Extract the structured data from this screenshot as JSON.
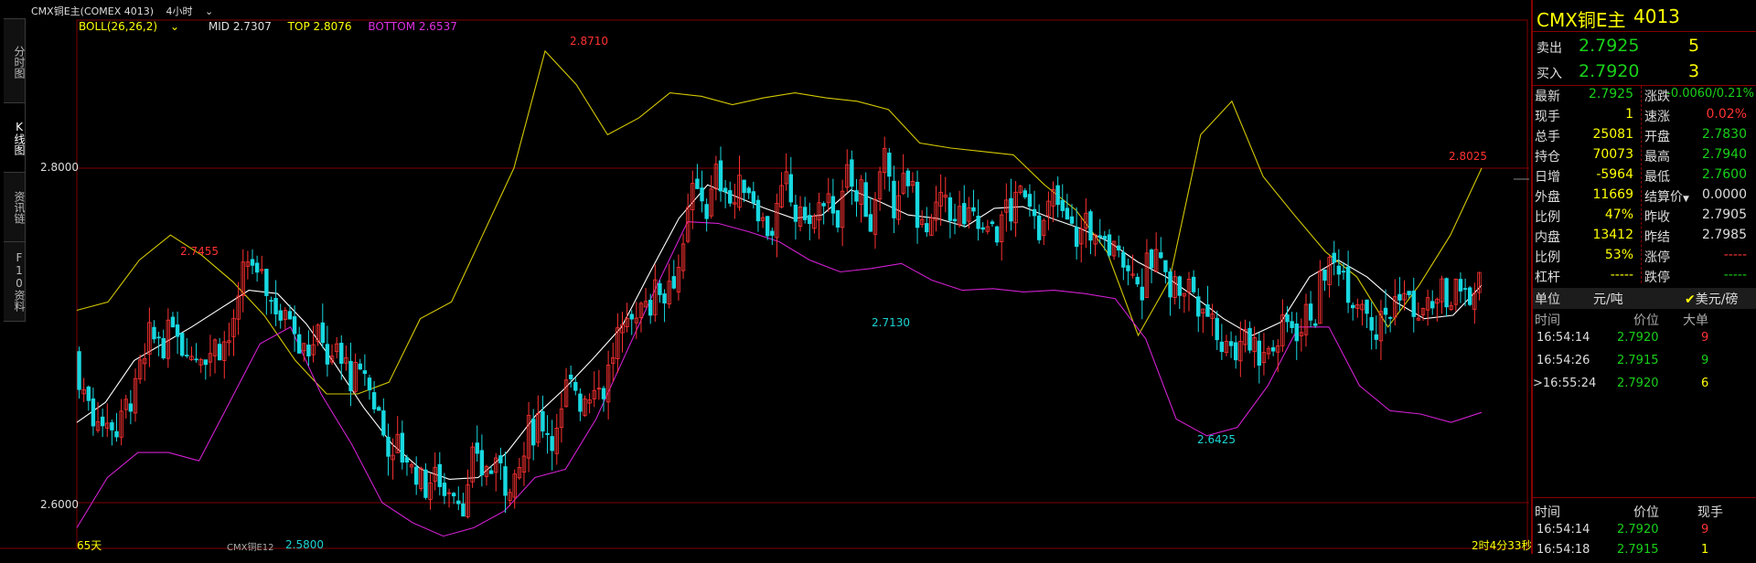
{
  "colors": {
    "up": "#ff3232",
    "down": "#18d8e0",
    "mid": "#ffffff",
    "top": "#d4c800",
    "bottom": "#d020d0",
    "grid": "#800000"
  },
  "topbar": {
    "symbol": "CMX铜E主(COMEX 4013)",
    "period": "4小时",
    "period_icon": "chevron-down-icon"
  },
  "tabs": [
    {
      "label": "分时图"
    },
    {
      "label": "K线图"
    },
    {
      "label": "资讯链"
    },
    {
      "label": "F10资料"
    }
  ],
  "legend": {
    "boll": "BOLL(26,26,2)",
    "mid": "MID 2.7307",
    "top": "TOP 2.8076",
    "bottom": "BOTTOM 2.6537"
  },
  "yaxis": {
    "high": "2.8000",
    "low": "2.6000"
  },
  "annotations": {
    "a1": "2.8710",
    "a2": "2.7455",
    "a3": "2.7130",
    "a4": "2.6425",
    "a5": "2.8025",
    "a6": "2.5800"
  },
  "footer": {
    "days": "65天",
    "contract": "CMX铜E12",
    "countdown": "2时4分33秒"
  },
  "chart_data": {
    "type": "candlestick",
    "ylim": [
      2.58,
      2.875
    ],
    "yticks": [
      "2.8000",
      "2.6000"
    ],
    "series": [
      {
        "name": "MID",
        "values": [
          2.648,
          2.66,
          2.685,
          2.695,
          2.705,
          2.716,
          2.727,
          2.725,
          2.707,
          2.683,
          2.657,
          2.635,
          2.62,
          2.614,
          2.615,
          2.63,
          2.652,
          2.668,
          2.686,
          2.705,
          2.738,
          2.77,
          2.79,
          2.783,
          2.776,
          2.77,
          2.772,
          2.787,
          2.78,
          2.772,
          2.77,
          2.765,
          2.776,
          2.777,
          2.77,
          2.764,
          2.756,
          2.744,
          2.735,
          2.723,
          2.71,
          2.7,
          2.708,
          2.735,
          2.745,
          2.735,
          2.72,
          2.71,
          2.712,
          2.73
        ]
      },
      {
        "name": "TOP",
        "values": [
          2.715,
          2.72,
          2.745,
          2.76,
          2.748,
          2.732,
          2.712,
          2.685,
          2.665,
          2.665,
          2.672,
          2.71,
          2.72,
          2.76,
          2.8,
          2.87,
          2.85,
          2.82,
          2.83,
          2.845,
          2.843,
          2.838,
          2.842,
          2.845,
          2.842,
          2.84,
          2.835,
          2.815,
          2.812,
          2.81,
          2.808,
          2.79,
          2.775,
          2.75,
          2.7,
          2.733,
          2.82,
          2.84,
          2.795,
          2.772,
          2.75,
          2.735,
          2.705,
          2.73,
          2.76,
          2.8
        ]
      },
      {
        "name": "BOTTOM",
        "values": [
          2.585,
          2.615,
          2.63,
          2.63,
          2.625,
          2.66,
          2.695,
          2.705,
          2.665,
          2.635,
          2.6,
          2.588,
          2.58,
          2.585,
          2.595,
          2.615,
          2.62,
          2.65,
          2.69,
          2.73,
          2.768,
          2.767,
          2.762,
          2.756,
          2.745,
          2.738,
          2.74,
          2.743,
          2.733,
          2.727,
          2.728,
          2.726,
          2.727,
          2.725,
          2.722,
          2.698,
          2.65,
          2.64,
          2.645,
          2.67,
          2.705,
          2.705,
          2.67,
          2.655,
          2.653,
          2.648,
          2.654
        ]
      }
    ]
  },
  "panel": {
    "title": "CMX铜E主",
    "code": "4013",
    "sell": {
      "label": "卖出",
      "price": "2.7925",
      "qty": "5"
    },
    "buy": {
      "label": "买入",
      "price": "2.7920",
      "qty": "3"
    },
    "stats": [
      {
        "l1": "最新",
        "v1": "2.7925",
        "c1": "green",
        "l2": "涨跌",
        "v2": "-0.0060/0.21%",
        "c2": "green"
      },
      {
        "l1": "现手",
        "v1": "1",
        "c1": "yellow",
        "l2": "速涨",
        "v2": "0.02%",
        "c2": "red"
      },
      {
        "l1": "总手",
        "v1": "25081",
        "c1": "yellow",
        "l2": "开盘",
        "v2": "2.7830",
        "c2": "green"
      },
      {
        "l1": "持仓",
        "v1": "70073",
        "c1": "yellow",
        "l2": "最高",
        "v2": "2.7940",
        "c2": "green"
      },
      {
        "l1": "日增",
        "v1": "-5964",
        "c1": "yellow",
        "l2": "最低",
        "v2": "2.7600",
        "c2": "green"
      },
      {
        "l1": "外盘",
        "v1": "11669",
        "c1": "yellow",
        "l2": "结算价",
        "v2": "0.0000",
        "c2": "white"
      },
      {
        "l1": "比例",
        "v1": "47%",
        "c1": "yellow",
        "l2": "昨收",
        "v2": "2.7905",
        "c2": "white"
      },
      {
        "l1": "内盘",
        "v1": "13412",
        "c1": "yellow",
        "l2": "昨结",
        "v2": "2.7985",
        "c2": "white"
      },
      {
        "l1": "比例",
        "v1": "53%",
        "c1": "yellow",
        "l2": "涨停",
        "v2": "-----",
        "c2": "red"
      },
      {
        "l1": "杠杆",
        "v1": "-----",
        "c1": "yellow",
        "l2": "跌停",
        "v2": "-----",
        "c2": "green"
      }
    ],
    "unit": {
      "label": "单位",
      "cny": "元/吨",
      "usd": "美元/磅"
    },
    "ticks_header": {
      "time": "时间",
      "price": "价位",
      "size": "大单"
    },
    "ticks": [
      {
        "time": "16:54:14",
        "price": "2.7920",
        "size": "9",
        "sc": "red"
      },
      {
        "time": "16:54:26",
        "price": "2.7915",
        "size": "9",
        "sc": "green"
      },
      {
        "time": ">16:55:24",
        "price": "2.7920",
        "size": "6",
        "sc": "yellow"
      }
    ],
    "ticks2_header": {
      "time": "时间",
      "price": "价位",
      "size": "现手"
    },
    "ticks2": [
      {
        "time": "16:54:14",
        "price": "2.7920",
        "size": "9",
        "sc": "red"
      },
      {
        "time": "16:54:18",
        "price": "2.7915",
        "size": "1",
        "sc": "yellow"
      }
    ]
  }
}
